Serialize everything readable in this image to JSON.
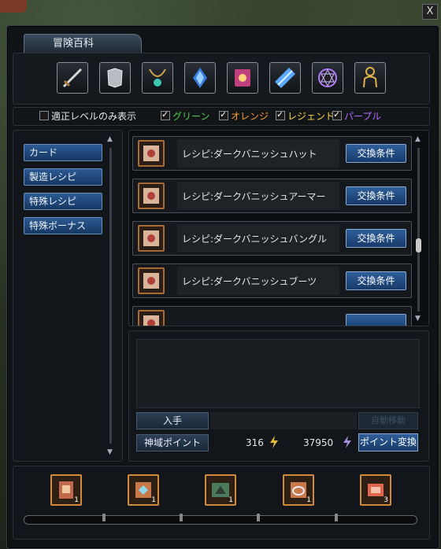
{
  "window": {
    "title": "冒険百科",
    "close_label": "X"
  },
  "categories": [
    {
      "name": "sword-category",
      "icon": "sword-icon"
    },
    {
      "name": "armor-category",
      "icon": "armor-icon"
    },
    {
      "name": "necklace-category",
      "icon": "necklace-icon"
    },
    {
      "name": "crystal-cluster-category",
      "icon": "crystal-cluster-icon"
    },
    {
      "name": "spellbook-category",
      "icon": "spellbook-icon"
    },
    {
      "name": "crystal-category",
      "icon": "crystal-icon"
    },
    {
      "name": "magic-circle-category",
      "icon": "magic-circle-icon"
    },
    {
      "name": "figure-category",
      "icon": "figure-icon"
    }
  ],
  "filters": {
    "level_only": {
      "label": "適正レベルのみ表示",
      "checked": false
    },
    "green": {
      "label": "グリーン",
      "checked": true,
      "color": "#4cd14c"
    },
    "orange": {
      "label": "オレンジ",
      "checked": true,
      "color": "#ff9c2a"
    },
    "legend": {
      "label": "レジェンド",
      "checked": true,
      "color": "#ffd54a"
    },
    "purple": {
      "label": "パープル",
      "checked": true,
      "color": "#b36bff"
    }
  },
  "sidebar": {
    "items": [
      {
        "label": "カード"
      },
      {
        "label": "製造レシピ"
      },
      {
        "label": "特殊レシピ"
      },
      {
        "label": "特殊ボーナス"
      }
    ]
  },
  "recipes": {
    "button_label": "交換条件",
    "items": [
      {
        "name": "レシピ:ダークバニッシュハット"
      },
      {
        "name": "レシピ:ダークバニッシュアーマー"
      },
      {
        "name": "レシピ:ダークバニッシュバングル"
      },
      {
        "name": "レシピ:ダークバニッシュブーツ"
      }
    ]
  },
  "detail": {
    "acquire_label": "入手",
    "auto_move_label": "自動移動",
    "points_label": "神域ポイント",
    "points_value_1": "316",
    "points_value_2": "37950",
    "convert_label": "ポイント変換"
  },
  "bottom": {
    "slots": [
      {
        "icon": "recipe-card-icon",
        "count": "1"
      },
      {
        "icon": "gem-card-icon",
        "count": "1"
      },
      {
        "icon": "map-card-icon",
        "count": "1"
      },
      {
        "icon": "ring-card-icon",
        "count": "1"
      },
      {
        "icon": "ticket-card-icon",
        "count": "3"
      }
    ]
  }
}
